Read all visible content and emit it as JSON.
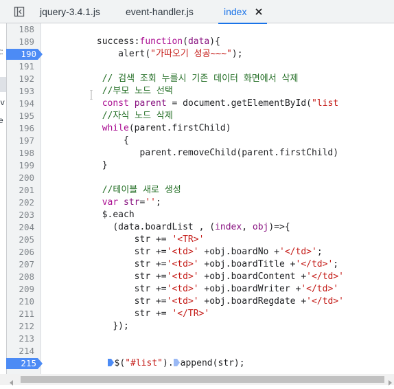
{
  "tabs": [
    {
      "label": "jquery-3.4.1.js",
      "active": false
    },
    {
      "label": "event-handler.js",
      "active": false
    },
    {
      "label": "index",
      "active": true
    }
  ],
  "left_panel_fragments": [
    "t:",
    "iv",
    "e"
  ],
  "line_numbers": [
    "188",
    "189",
    "190",
    "191",
    "192",
    "193",
    "194",
    "195",
    "196",
    "197",
    "198",
    "199",
    "200",
    "201",
    "202",
    "203",
    "204",
    "205",
    "206",
    "207",
    "208",
    "209",
    "210",
    "211",
    "212",
    "213",
    "214",
    "215"
  ],
  "breakpoints": [
    "190",
    "215"
  ],
  "code_lines": [
    [],
    [
      {
        "t": "                  success:",
        "c": ""
      },
      {
        "t": "function",
        "c": "kw"
      },
      {
        "t": "(",
        "c": ""
      },
      {
        "t": "data",
        "c": "ids"
      },
      {
        "t": "){",
        "c": ""
      }
    ],
    [
      {
        "t": "                      alert(",
        "c": ""
      },
      {
        "t": "\"가따오기 성공~~~\"",
        "c": "str"
      },
      {
        "t": ");",
        "c": ""
      }
    ],
    [],
    [
      {
        "t": "                   // 검색 조회 누를시 기존 데이터 화면에서 삭제",
        "c": "cm"
      }
    ],
    [
      {
        "t": "                   //부모 노드 선택",
        "c": "cm"
      }
    ],
    [
      {
        "t": "                   ",
        "c": ""
      },
      {
        "t": "const",
        "c": "kw"
      },
      {
        "t": " ",
        "c": ""
      },
      {
        "t": "parent",
        "c": "ids"
      },
      {
        "t": " = document.getElementById(",
        "c": ""
      },
      {
        "t": "\"list",
        "c": "str"
      }
    ],
    [
      {
        "t": "                   //자식 노드 삭제",
        "c": "cm"
      }
    ],
    [
      {
        "t": "                   ",
        "c": ""
      },
      {
        "t": "while",
        "c": "kw"
      },
      {
        "t": "(parent.firstChild)",
        "c": ""
      }
    ],
    [
      {
        "t": "                       {",
        "c": ""
      }
    ],
    [
      {
        "t": "                          parent.removeChild(parent.firstChild)",
        "c": ""
      }
    ],
    [
      {
        "t": "                   }",
        "c": ""
      }
    ],
    [],
    [
      {
        "t": "                   //테이블 새로 생성",
        "c": "cm"
      }
    ],
    [
      {
        "t": "                   ",
        "c": ""
      },
      {
        "t": "var",
        "c": "kw"
      },
      {
        "t": " ",
        "c": ""
      },
      {
        "t": "str",
        "c": "ids"
      },
      {
        "t": "=",
        "c": ""
      },
      {
        "t": "''",
        "c": "str"
      },
      {
        "t": ";",
        "c": ""
      }
    ],
    [
      {
        "t": "                   $.each",
        "c": ""
      }
    ],
    [
      {
        "t": "                     (data.boardList , (",
        "c": ""
      },
      {
        "t": "index",
        "c": "ids"
      },
      {
        "t": ", ",
        "c": ""
      },
      {
        "t": "obj",
        "c": "ids"
      },
      {
        "t": ")=>{",
        "c": ""
      }
    ],
    [
      {
        "t": "                         str += ",
        "c": ""
      },
      {
        "t": "'<TR>'",
        "c": "str"
      }
    ],
    [
      {
        "t": "                         str +=",
        "c": ""
      },
      {
        "t": "'<td>'",
        "c": "str"
      },
      {
        "t": " +obj.boardNo +",
        "c": ""
      },
      {
        "t": "'</td>'",
        "c": "str"
      },
      {
        "t": ";",
        "c": ""
      }
    ],
    [
      {
        "t": "                         str +=",
        "c": ""
      },
      {
        "t": "'<td>'",
        "c": "str"
      },
      {
        "t": " +obj.boardTitle +",
        "c": ""
      },
      {
        "t": "'</td>'",
        "c": "str"
      },
      {
        "t": ";",
        "c": ""
      }
    ],
    [
      {
        "t": "                         str +=",
        "c": ""
      },
      {
        "t": "'<td>'",
        "c": "str"
      },
      {
        "t": " +obj.boardContent +",
        "c": ""
      },
      {
        "t": "'</td>'",
        "c": "str"
      }
    ],
    [
      {
        "t": "                         str +=",
        "c": ""
      },
      {
        "t": "'<td>'",
        "c": "str"
      },
      {
        "t": " +obj.boardWriter +",
        "c": ""
      },
      {
        "t": "'</td>'",
        "c": "str"
      }
    ],
    [
      {
        "t": "                         str +=",
        "c": ""
      },
      {
        "t": "'<td>'",
        "c": "str"
      },
      {
        "t": " +obj.boardRegdate +",
        "c": ""
      },
      {
        "t": "'</td>'",
        "c": "str"
      }
    ],
    [
      {
        "t": "                         str += ",
        "c": ""
      },
      {
        "t": "'</TR>'",
        "c": "str"
      }
    ],
    [
      {
        "t": "                     });",
        "c": ""
      }
    ],
    [],
    [],
    [
      {
        "t": "                    ",
        "c": ""
      },
      {
        "t": "MARK",
        "c": "mark"
      },
      {
        "t": "$(",
        "c": ""
      },
      {
        "t": "\"#list\"",
        "c": "str"
      },
      {
        "t": ").",
        "c": ""
      },
      {
        "t": "MARK2",
        "c": "mark2"
      },
      {
        "t": "append(str);",
        "c": ""
      }
    ]
  ],
  "colors": {
    "accent": "#1a73e8",
    "breakpoint": "#4c8bf5",
    "keyword": "#aa0d91",
    "string": "#c41a16",
    "comment": "#236e25"
  }
}
